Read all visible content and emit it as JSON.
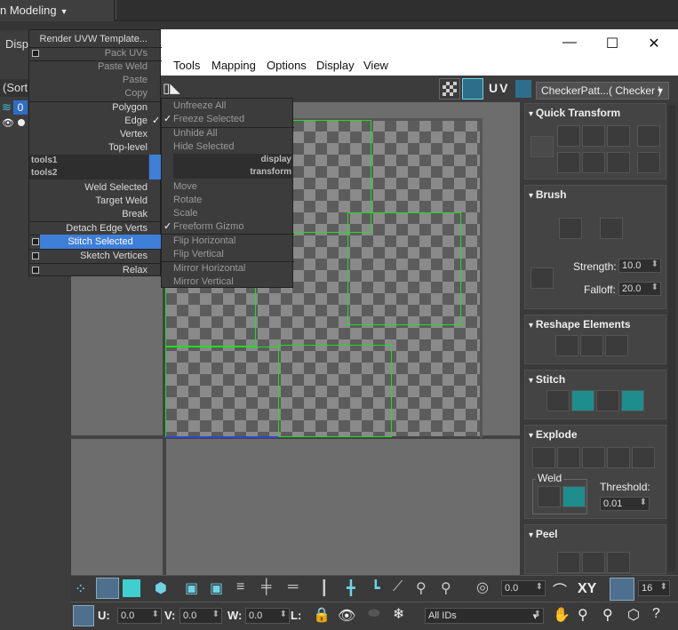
{
  "topbar": {
    "mode_label": "n Modeling"
  },
  "leftpanel": {
    "disp_label": "Disp",
    "sort_label": "(Sort",
    "layer_badge": "0"
  },
  "window": {
    "controls": {
      "minimize": "—",
      "maximize": "☐",
      "close": "✕"
    }
  },
  "menubar": {
    "items": [
      "Tools",
      "Mapping",
      "Options",
      "Display",
      "View"
    ]
  },
  "toolbar": {
    "uv_label": "UV",
    "texture_select": "CheckerPatt...( Checker )",
    "texture_arrow": "▾"
  },
  "context_menu": {
    "left": {
      "render_uvw_template": "Render UVW Template...",
      "pack_uvs": "Pack UVs",
      "paste_weld": "Paste Weld",
      "paste": "Paste",
      "copy": "Copy",
      "polygon": "Polygon",
      "edge": "Edge",
      "vertex": "Vertex",
      "top_level": "Top-level",
      "tools1": "tools1",
      "tools2": "tools2",
      "weld_selected": "Weld Selected",
      "target_weld": "Target Weld",
      "break": "Break",
      "detach_edge_verts": "Detach Edge Verts",
      "stitch_selected": "Stitch Selected",
      "sketch_vertices": "Sketch Vertices",
      "relax": "Relax"
    },
    "right": {
      "unfreeze_all": "Unfreeze All",
      "freeze_selected": "Freeze Selected",
      "unhide_all": "Unhide All",
      "hide_selected": "Hide Selected",
      "display": "display",
      "transform": "transform",
      "move": "Move",
      "rotate": "Rotate",
      "scale": "Scale",
      "freeform_gizmo": "Freeform Gizmo",
      "flip_horizontal": "Flip Horizontal",
      "flip_vertical": "Flip Vertical",
      "mirror_horizontal": "Mirror Horizontal",
      "mirror_vertical": "Mirror Vertical"
    },
    "check": "✓"
  },
  "panel": {
    "quick_transform": "Quick Transform",
    "brush": "Brush",
    "strength_label": "Strength:",
    "strength_value": "10.0",
    "falloff_label": "Falloff:",
    "falloff_value": "20.0",
    "reshape_elements": "Reshape Elements",
    "stitch": "Stitch",
    "explode": "Explode",
    "weld": "Weld",
    "threshold_label": "Threshold:",
    "threshold_value": "0.01",
    "peel": "Peel"
  },
  "bottom": {
    "angle_value": "0.0",
    "xy_label": "XY",
    "grid_value": "16",
    "u_label": "U:",
    "u_value": "0.0",
    "v_label": "V:",
    "v_value": "0.0",
    "w_label": "W:",
    "w_value": "0.0",
    "l_label": "L:",
    "ids_select": "All IDs",
    "ids_arrow": "▾"
  },
  "colors": {
    "accent": "#3d7fd9",
    "teal": "#1d8d8d",
    "uv_shell": "#22dd22"
  }
}
